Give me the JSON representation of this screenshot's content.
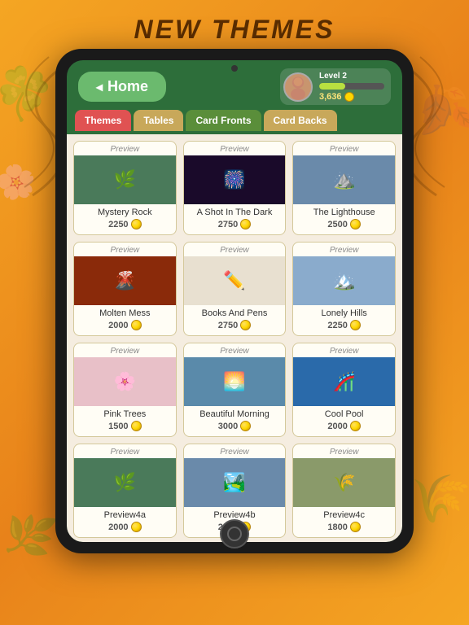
{
  "page": {
    "title": "NEW THEMES",
    "background_color": "#f5a623"
  },
  "header": {
    "home_button": "Home",
    "player": {
      "level": "Level 2",
      "xp": 40,
      "score": "3,636",
      "avatar_label": "player-avatar"
    }
  },
  "tabs": [
    {
      "id": "themes",
      "label": "Themes",
      "active": true
    },
    {
      "id": "tables",
      "label": "Tables",
      "active": false
    },
    {
      "id": "card-fronts",
      "label": "Card Fronts",
      "active": false
    },
    {
      "id": "card-backs",
      "label": "Card Backs",
      "active": false
    }
  ],
  "themes": [
    {
      "name": "Mystery Rock",
      "price": "2250",
      "emoji": "🌿",
      "bg": "#4a7a5a"
    },
    {
      "name": "A Shot In The Dark",
      "price": "2750",
      "emoji": "🎆",
      "bg": "#1a0a2a"
    },
    {
      "name": "The Lighthouse",
      "price": "2500",
      "emoji": "⛰️",
      "bg": "#6a8aaa"
    },
    {
      "name": "Molten Mess",
      "price": "2000",
      "emoji": "🌋",
      "bg": "#8a2a0a"
    },
    {
      "name": "Books And Pens",
      "price": "2750",
      "emoji": "✏️",
      "bg": "#e8e0d0"
    },
    {
      "name": "Lonely Hills",
      "price": "2250",
      "emoji": "🏔️",
      "bg": "#8aabcc"
    },
    {
      "name": "Pink Trees",
      "price": "1500",
      "emoji": "🌸",
      "bg": "#e8c0c8"
    },
    {
      "name": "Beautiful Morning",
      "price": "3000",
      "emoji": "🌅",
      "bg": "#5a8aaa"
    },
    {
      "name": "Cool Pool",
      "price": "2000",
      "emoji": "🎢",
      "bg": "#2a6aaa"
    },
    {
      "name": "Preview4a",
      "price": "2000",
      "emoji": "🌿",
      "bg": "#4a7a5a"
    },
    {
      "name": "Preview4b",
      "price": "2500",
      "emoji": "🏞️",
      "bg": "#6a8aaa"
    },
    {
      "name": "Preview4c",
      "price": "1800",
      "emoji": "🌾",
      "bg": "#8a9a6a"
    }
  ],
  "preview_label": "Preview"
}
